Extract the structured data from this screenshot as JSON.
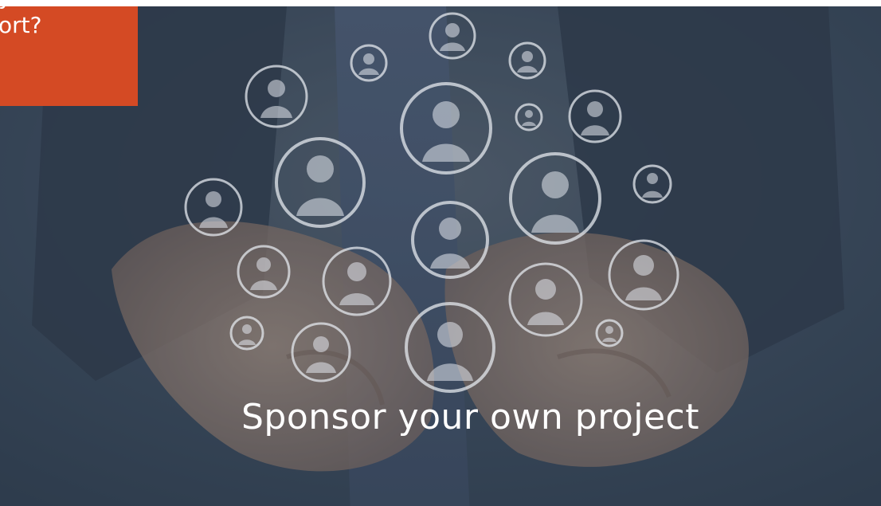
{
  "card": {
    "line_1": "y",
    "line_2": "ort?"
  },
  "headline": "Sponsor your own project",
  "colors": {
    "accent": "#d44a24",
    "overlay": "#33404f",
    "text": "#ffffff"
  },
  "image": {
    "icon": "hands-with-person-icons"
  }
}
